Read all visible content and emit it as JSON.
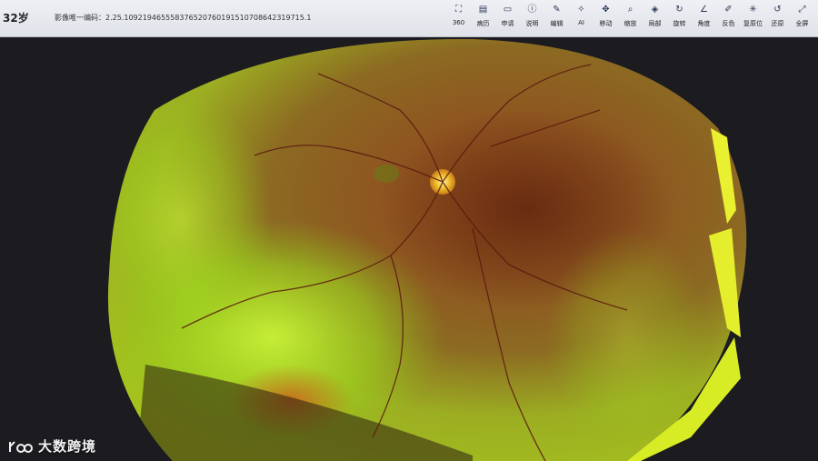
{
  "header": {
    "age": "32岁",
    "image_uid": "影像唯一编码：2.25.109219465558376520760191510708642319715.1"
  },
  "toolbar": {
    "tools": [
      {
        "icon": "360-icon",
        "glyph": "⛶",
        "label": "360"
      },
      {
        "icon": "history-icon",
        "glyph": "▤",
        "label": "病历"
      },
      {
        "icon": "request-icon",
        "glyph": "▭",
        "label": "申请"
      },
      {
        "icon": "info-icon",
        "glyph": "ⓘ",
        "label": "说明"
      },
      {
        "icon": "edit-icon",
        "glyph": "✎",
        "label": "编辑"
      },
      {
        "icon": "ai-icon",
        "glyph": "✧",
        "label": "AI"
      },
      {
        "icon": "move-icon",
        "glyph": "✥",
        "label": "移动"
      },
      {
        "icon": "zoom-icon",
        "glyph": "⌕",
        "label": "缩放"
      },
      {
        "icon": "local-icon",
        "glyph": "◈",
        "label": "局部"
      },
      {
        "icon": "rotate-icon",
        "glyph": "↻",
        "label": "旋转"
      },
      {
        "icon": "measure-icon",
        "glyph": "∠",
        "label": "角度"
      },
      {
        "icon": "color-icon",
        "glyph": "✐",
        "label": "反色"
      },
      {
        "icon": "reset-position-icon",
        "glyph": "✳",
        "label": "复原位"
      },
      {
        "icon": "restore-icon",
        "glyph": "↺",
        "label": "还原"
      },
      {
        "icon": "fullscreen-icon",
        "glyph": "⤢",
        "label": "全屏"
      }
    ]
  },
  "watermark": {
    "text": "大数跨境"
  },
  "colors": {
    "toolbar_bg": "#e4e7ec",
    "fundus_bright": "#b8d21a",
    "fundus_dark": "#6a2a12"
  }
}
